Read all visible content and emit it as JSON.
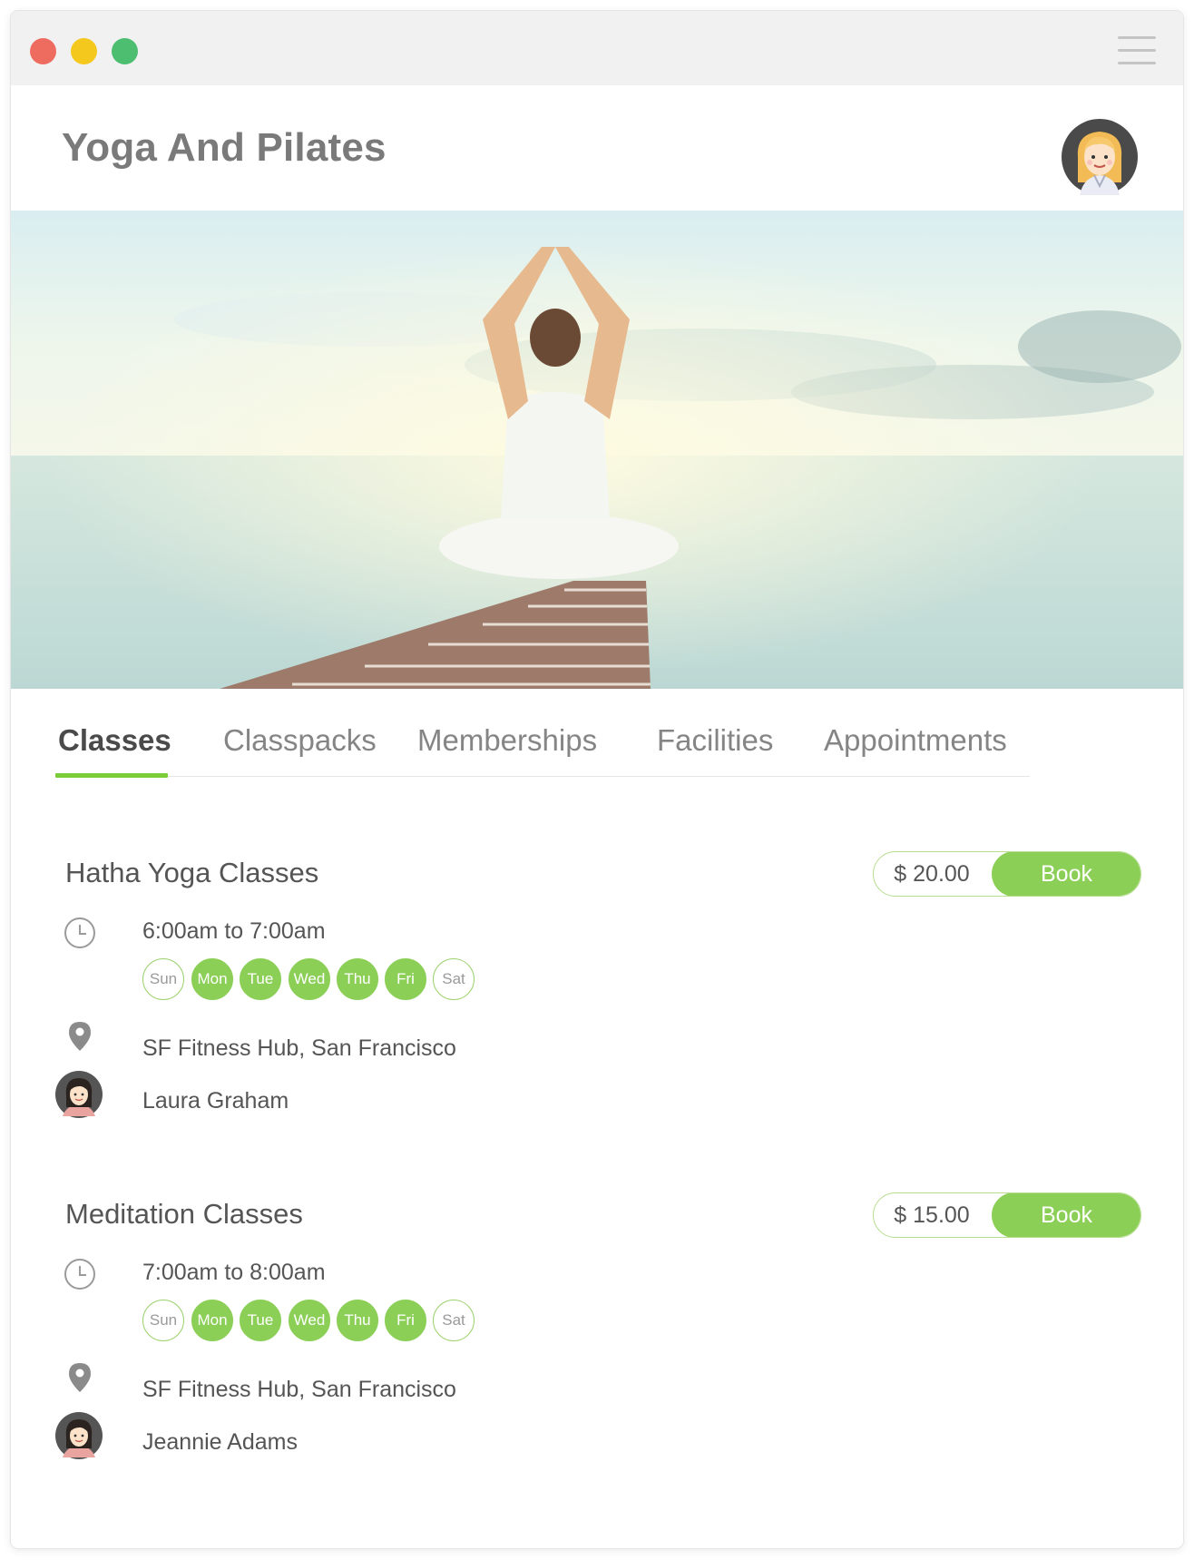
{
  "app": {
    "title": "Yoga And Pilates"
  },
  "tabs": [
    "Classes",
    "Classpacks",
    "Memberships",
    "Facilities",
    "Appointments"
  ],
  "active_tab": "Classes",
  "classes": [
    {
      "title": "Hatha Yoga Classes",
      "price": "$ 20.00",
      "book_label": "Book",
      "time": "6:00am to 7:00am",
      "days": [
        "Sun",
        "Mon",
        "Tue",
        "Wed",
        "Thu",
        "Fri",
        "Sat"
      ],
      "active_days": [
        false,
        true,
        true,
        true,
        true,
        true,
        false
      ],
      "location": "SF Fitness Hub, San Francisco",
      "instructor": "Laura Graham"
    },
    {
      "title": "Meditation Classes",
      "price": "$ 15.00",
      "book_label": "Book",
      "time": "7:00am to 8:00am",
      "days": [
        "Sun",
        "Mon",
        "Tue",
        "Wed",
        "Thu",
        "Fri",
        "Sat"
      ],
      "active_days": [
        false,
        true,
        true,
        true,
        true,
        true,
        false
      ],
      "location": "SF Fitness Hub, San Francisco",
      "instructor": "Jeannie Adams"
    }
  ],
  "colors": {
    "accent": "#8bcf57",
    "tab_underline": "#7ccc3a",
    "title": "#7a7a7a"
  }
}
